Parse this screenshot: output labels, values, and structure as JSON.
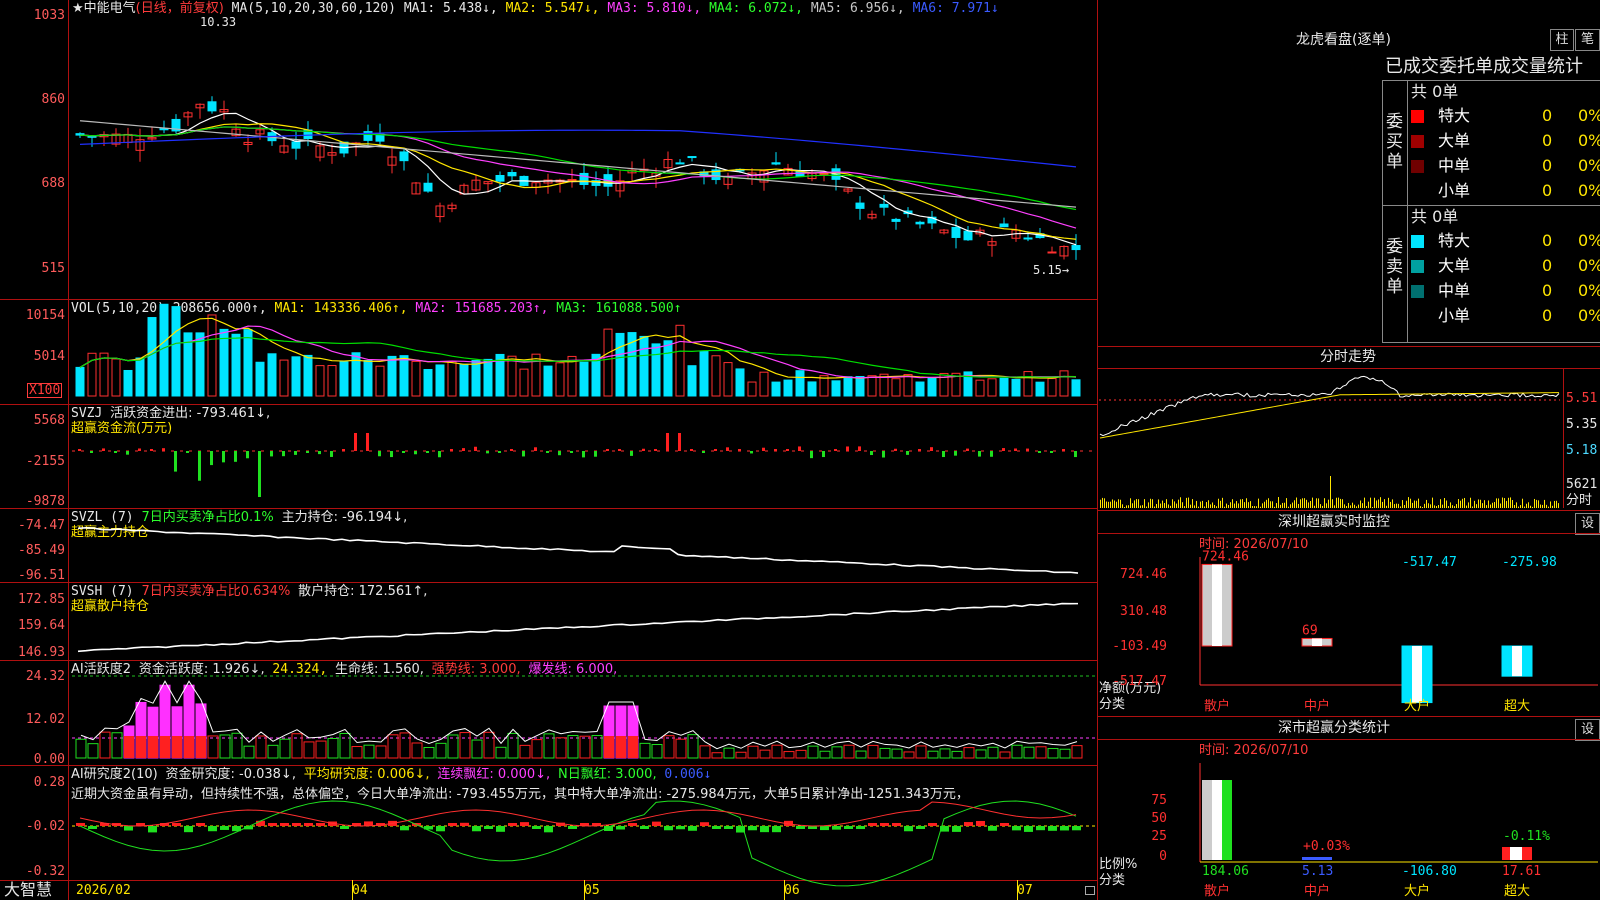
{
  "colors": {
    "up": "#ff3030",
    "down": "#00e5ff",
    "ma1": "#ffffff",
    "ma2": "#ffe600",
    "ma3": "#ff40ff",
    "ma4": "#00dd00",
    "ma5": "#bbbbbb",
    "ma6": "#2030ff",
    "grid": "#b01010"
  },
  "kline": {
    "stock": "★中能电气",
    "period": "(日线，前复权)",
    "ma_params": "MA(5,10,20,30,60,120)",
    "ma1": "MA1: 5.438↓,",
    "ma2": "MA2: 5.547↓,",
    "ma3": "MA3: 5.810↓,",
    "ma4": "MA4: 6.072↓,",
    "ma5": "MA5: 6.956↓,",
    "ma6": "MA6: 7.971↓",
    "high_mark": "10.33",
    "low_mark": "5.15→",
    "yaxis": [
      "1033",
      "860",
      "688",
      "515"
    ]
  },
  "vol": {
    "label": "VOL(5,10,20)",
    "value": "208656.000↑,",
    "ma1": "MA1: 143336.406↑,",
    "ma2": "MA2: 151685.203↑,",
    "ma3": "MA3: 161088.500↑",
    "yaxis": [
      "10154",
      "5014"
    ],
    "unit": "X100"
  },
  "svzj": {
    "label": "SVZJ",
    "text": "活跃资金进出: -793.461↓,",
    "sub": "超赢资金流(万元)",
    "yaxis": [
      "5568",
      "-2155",
      "-9878"
    ]
  },
  "svzl": {
    "label": "SVZL (7)",
    "pct": "7日内买卖净占比0.1%",
    "main": "主力持仓: -96.194↓,",
    "sub": "超赢主力持仓",
    "yaxis": [
      "-74.47",
      "-85.49",
      "-96.51"
    ]
  },
  "svsh": {
    "label": "SVSH (7)",
    "pct": "7日内买卖净占比0.634%",
    "main": "散户持仓: 172.561↑,",
    "sub": "超赢散户持仓",
    "yaxis": [
      "172.85",
      "159.64",
      "146.93"
    ]
  },
  "ai1": {
    "label": "AI活跃度2",
    "a": "资金活跃度: 1.926↓,",
    "b": "24.324,",
    "c": "生命线: 1.560,",
    "d": "强势线: 3.000,",
    "e": "爆发线: 6.000,",
    "yaxis": [
      "24.32",
      "12.02",
      "0.00"
    ]
  },
  "ai2": {
    "label": "AI研究度2(10)",
    "a": "资金研究度: -0.038↓,",
    "b": "平均研究度: 0.006↓,",
    "c": "连续飘红: 0.000↓,",
    "d": "N日飘红: 3.000,",
    "e": "0.006↓",
    "comment": "近期大资金虽有异动，但持续性不强，总体偏空，今日大单净流出: -793.455万元，其中特大单净流出: -275.984万元，大单5日累计净出-1251.343万元，",
    "yaxis": [
      "0.28",
      "-0.02",
      "-0.32"
    ]
  },
  "bottom": {
    "app": "大智慧",
    "dates": [
      "2026/02",
      "04",
      "05",
      "06",
      "07"
    ]
  },
  "dragon": {
    "title": "龙虎看盘(逐单)",
    "btn1": "柱",
    "btn2": "笔",
    "header": "已成交委托单成交量统计",
    "buy_label": "委买单",
    "sell_label": "委卖单",
    "total": "共 0单",
    "rows": [
      {
        "name": "特大",
        "n": "0",
        "p": "0%",
        "color": "#ff0000"
      },
      {
        "name": "大单",
        "n": "0",
        "p": "0%",
        "color": "#a00000"
      },
      {
        "name": "中单",
        "n": "0",
        "p": "0%",
        "color": "#700000"
      },
      {
        "name": "小单",
        "n": "0",
        "p": "0%",
        "color": "#000000"
      }
    ],
    "rows_sell": [
      {
        "name": "特大",
        "n": "0",
        "p": "0%",
        "color": "#00e5ff"
      },
      {
        "name": "大单",
        "n": "0",
        "p": "0%",
        "color": "#00a0a0"
      },
      {
        "name": "中单",
        "n": "0",
        "p": "0%",
        "color": "#007070"
      },
      {
        "name": "小单",
        "n": "0",
        "p": "0%",
        "color": "#000000"
      }
    ]
  },
  "intraday": {
    "title": "分时走势",
    "prices": [
      "5.51",
      "5.35",
      "5.18"
    ],
    "vol": "5621",
    "unit": "分时"
  },
  "monitor": {
    "title": "深圳超赢实时监控",
    "btn": "设",
    "date": "时间: 2026/07/10",
    "yaxis": [
      "724.46",
      "310.48",
      "-103.49",
      "-517.47"
    ],
    "ylabel": "净额(万元)",
    "xlabel": "分类",
    "bars": [
      {
        "cat": "散户",
        "value": "724.46"
      },
      {
        "cat": "中户",
        "value": "69"
      },
      {
        "cat": "大户",
        "value": "-517.47"
      },
      {
        "cat": "超大",
        "value": "-275.98"
      }
    ]
  },
  "classify": {
    "title": "深市超赢分类统计",
    "btn": "设",
    "date": "时间: 2026/07/10",
    "yaxis": [
      "75",
      "50",
      "25",
      "0"
    ],
    "ylabel": "比例%",
    "xlabel": "分类",
    "bars": [
      {
        "cat": "散户",
        "value": "184.06",
        "pct": ""
      },
      {
        "cat": "中户",
        "value": "5.13",
        "pct": "+0.03%"
      },
      {
        "cat": "大户",
        "value": "-106.80",
        "pct": ""
      },
      {
        "cat": "超大",
        "value": "17.61",
        "pct": "-0.11%"
      }
    ]
  }
}
